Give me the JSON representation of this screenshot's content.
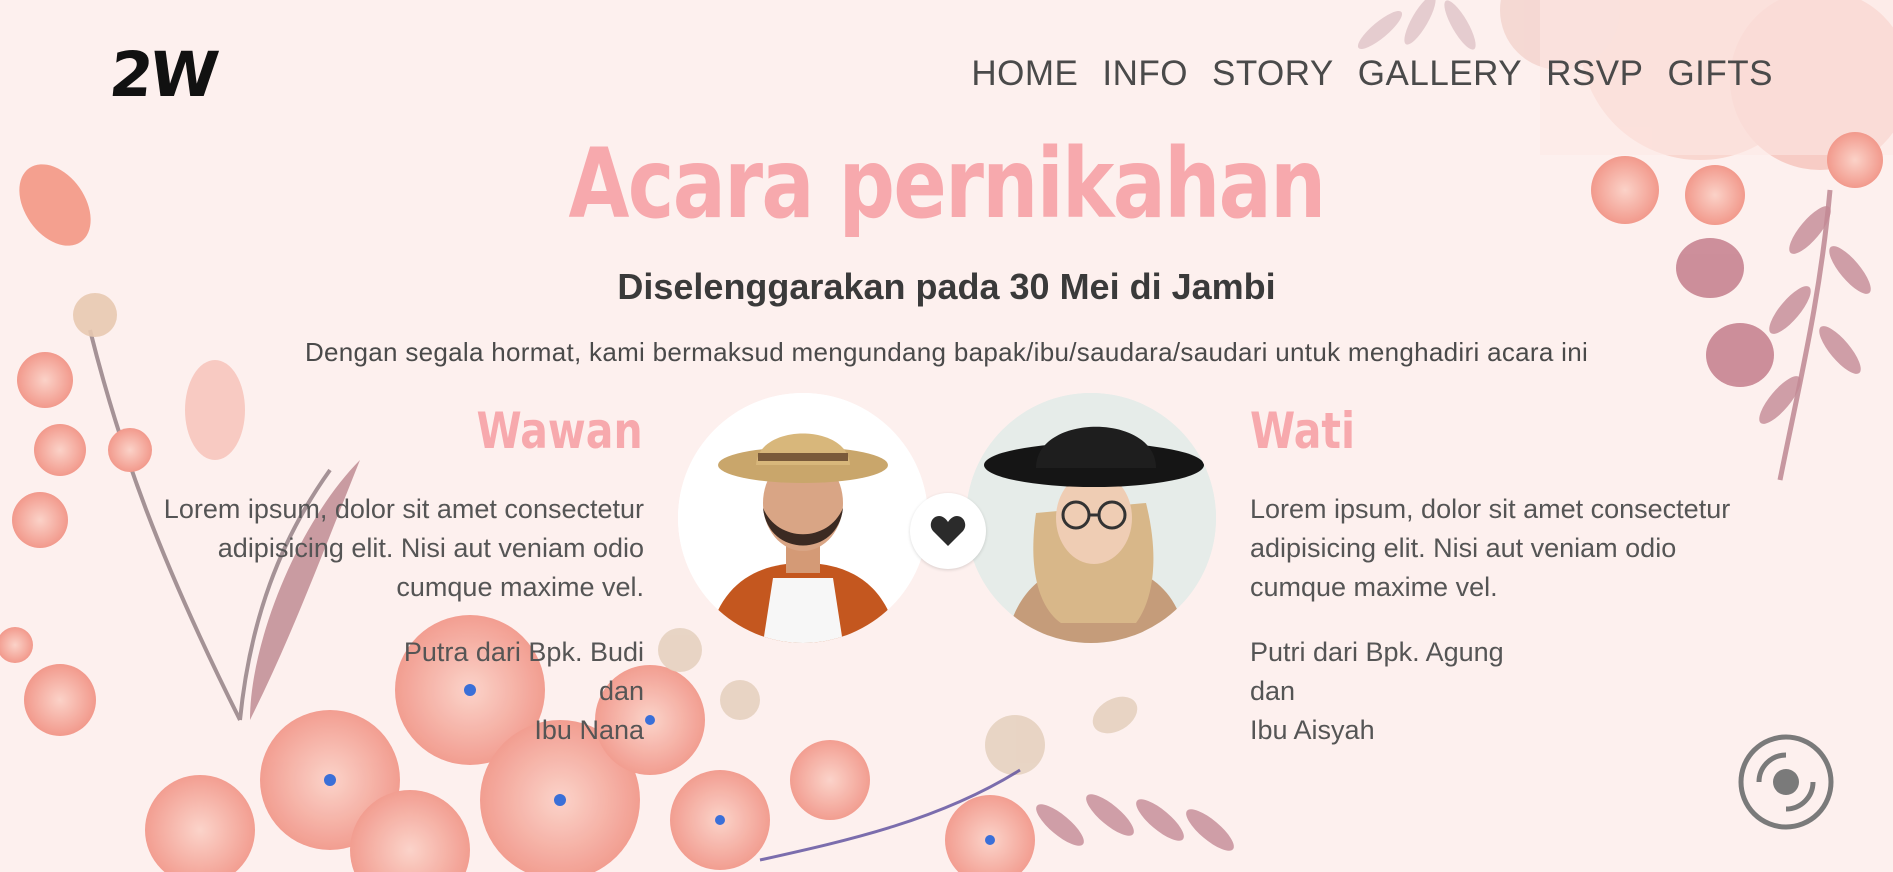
{
  "logo": "2W",
  "nav": {
    "items": [
      "HOME",
      "INFO",
      "STORY",
      "GALLERY",
      "RSVP",
      "GIFTS"
    ]
  },
  "hero": {
    "title": "Acara pernikahan",
    "subtitle": "Diselenggarakan pada 30 Mei di Jambi",
    "invitation": "Dengan segala hormat, kami bermaksud mengundang bapak/ibu/saudara/saudari untuk menghadiri acara ini"
  },
  "groom": {
    "name": "Wawan",
    "description": "Lorem ipsum, dolor sit amet consectetur adipisicing elit. Nisi aut veniam odio cumque maxime vel.",
    "parents": [
      "Putra dari Bpk. Budi",
      "dan",
      "Ibu Nana"
    ]
  },
  "bride": {
    "name": "Wati",
    "description": "Lorem ipsum, dolor sit amet consectetur adipisicing elit. Nisi aut veniam odio cumque maxime vel.",
    "parents": [
      "Putri dari Bpk. Agung",
      "dan",
      "Ibu Aisyah"
    ]
  },
  "icons": {
    "heart": "heart-icon",
    "music": "music-disc-icon"
  },
  "colors": {
    "background": "#fdf0ee",
    "accent_pink": "#f7a9ad",
    "text_dark": "#3a3a3a"
  }
}
